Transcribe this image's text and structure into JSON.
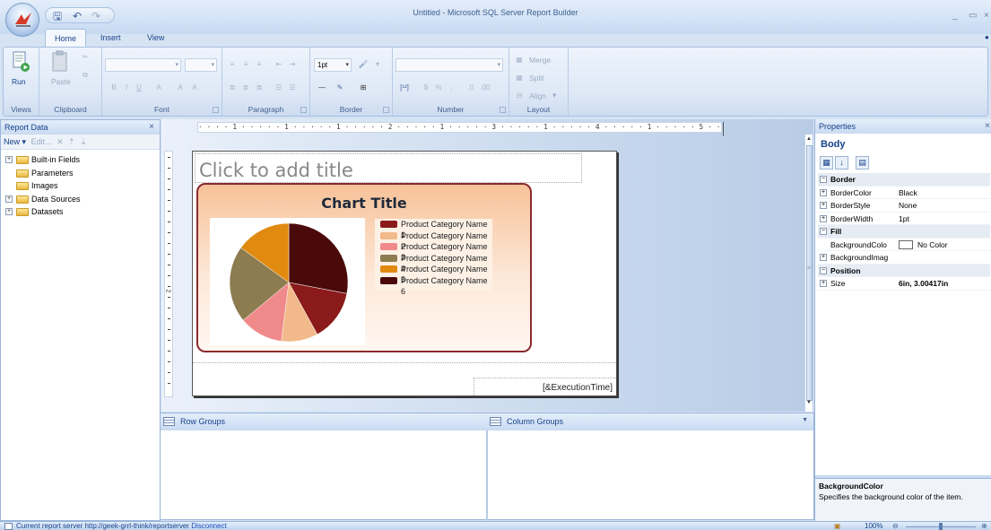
{
  "window": {
    "title": "Untitled - Microsoft SQL Server Report Builder"
  },
  "quick_access": {
    "icons": [
      "save-icon",
      "undo-icon",
      "redo-icon"
    ]
  },
  "tabs": [
    {
      "label": "Home",
      "active": true
    },
    {
      "label": "Insert",
      "active": false
    },
    {
      "label": "View",
      "active": false
    }
  ],
  "ribbon": {
    "groups": {
      "views": "Views",
      "clipboard": "Clipboard",
      "font": "Font",
      "paragraph": "Paragraph",
      "border": "Border",
      "number": "Number",
      "layout": "Layout"
    },
    "run_label": "Run",
    "paste_label": "Paste",
    "border_width": "1pt",
    "merge_label": "Merge",
    "split_label": "Split",
    "align_label": "Align"
  },
  "report_data": {
    "title": "Report Data",
    "new_label": "New",
    "edit_label": "Edit...",
    "items": [
      {
        "label": "Built-in Fields",
        "expandable": true
      },
      {
        "label": "Parameters",
        "expandable": false
      },
      {
        "label": "Images",
        "expandable": false
      },
      {
        "label": "Data Sources",
        "expandable": true
      },
      {
        "label": "Datasets",
        "expandable": true
      }
    ]
  },
  "ruler": {
    "text": "· · · · 1 · · · · · 1 · · · · · 1 · · · · · 2 · · · · · 1 · · · · · 3 · · · · · 1 · · · · · 4 · · · · · 1 · · · · · 5 · · · · · 1 · · · ·"
  },
  "vertical_ruler": {
    "label": "2"
  },
  "report": {
    "title_placeholder": "Click to add title",
    "execution_time": "[&ExecutionTime]"
  },
  "chart_data": {
    "type": "pie",
    "title": "Chart Title",
    "categories": [
      "Product Category Name 1",
      "Product Category Name 2",
      "Product Category Name 3",
      "Product Category Name 4",
      "Product Category Name 5",
      "Product Category Name 6"
    ],
    "colors": [
      "#8b1a1a",
      "#f2b98a",
      "#f08a8a",
      "#8c7c50",
      "#e08a10",
      "#4a0a0a"
    ],
    "values": [
      14,
      10,
      12,
      21,
      15,
      28
    ],
    "legend_position": "right"
  },
  "groups": {
    "row_groups": "Row Groups",
    "column_groups": "Column Groups"
  },
  "properties": {
    "title": "Properties",
    "object": "Body",
    "rows": [
      {
        "kind": "category",
        "name": "Border"
      },
      {
        "kind": "prop",
        "name": "BorderColor",
        "value": "Black",
        "expandable": true
      },
      {
        "kind": "prop",
        "name": "BorderStyle",
        "value": "None",
        "expandable": true
      },
      {
        "kind": "prop",
        "name": "BorderWidth",
        "value": "1pt",
        "expandable": true
      },
      {
        "kind": "category",
        "name": "Fill"
      },
      {
        "kind": "prop",
        "name": "BackgroundColo",
        "value": "No Color",
        "expandable": false,
        "swatch": true
      },
      {
        "kind": "prop",
        "name": "BackgroundImag",
        "value": "",
        "expandable": true
      },
      {
        "kind": "category",
        "name": "Position"
      },
      {
        "kind": "prop",
        "name": "Size",
        "value": "6in, 3.00417in",
        "expandable": true,
        "bold_value": true
      }
    ],
    "description_title": "BackgroundColor",
    "description_text": "Specifies the background color of the item."
  },
  "status": {
    "prefix": "Current report server http://geek-grrl-think/reportserver",
    "link": "Disconnect",
    "zoom": "100%"
  }
}
